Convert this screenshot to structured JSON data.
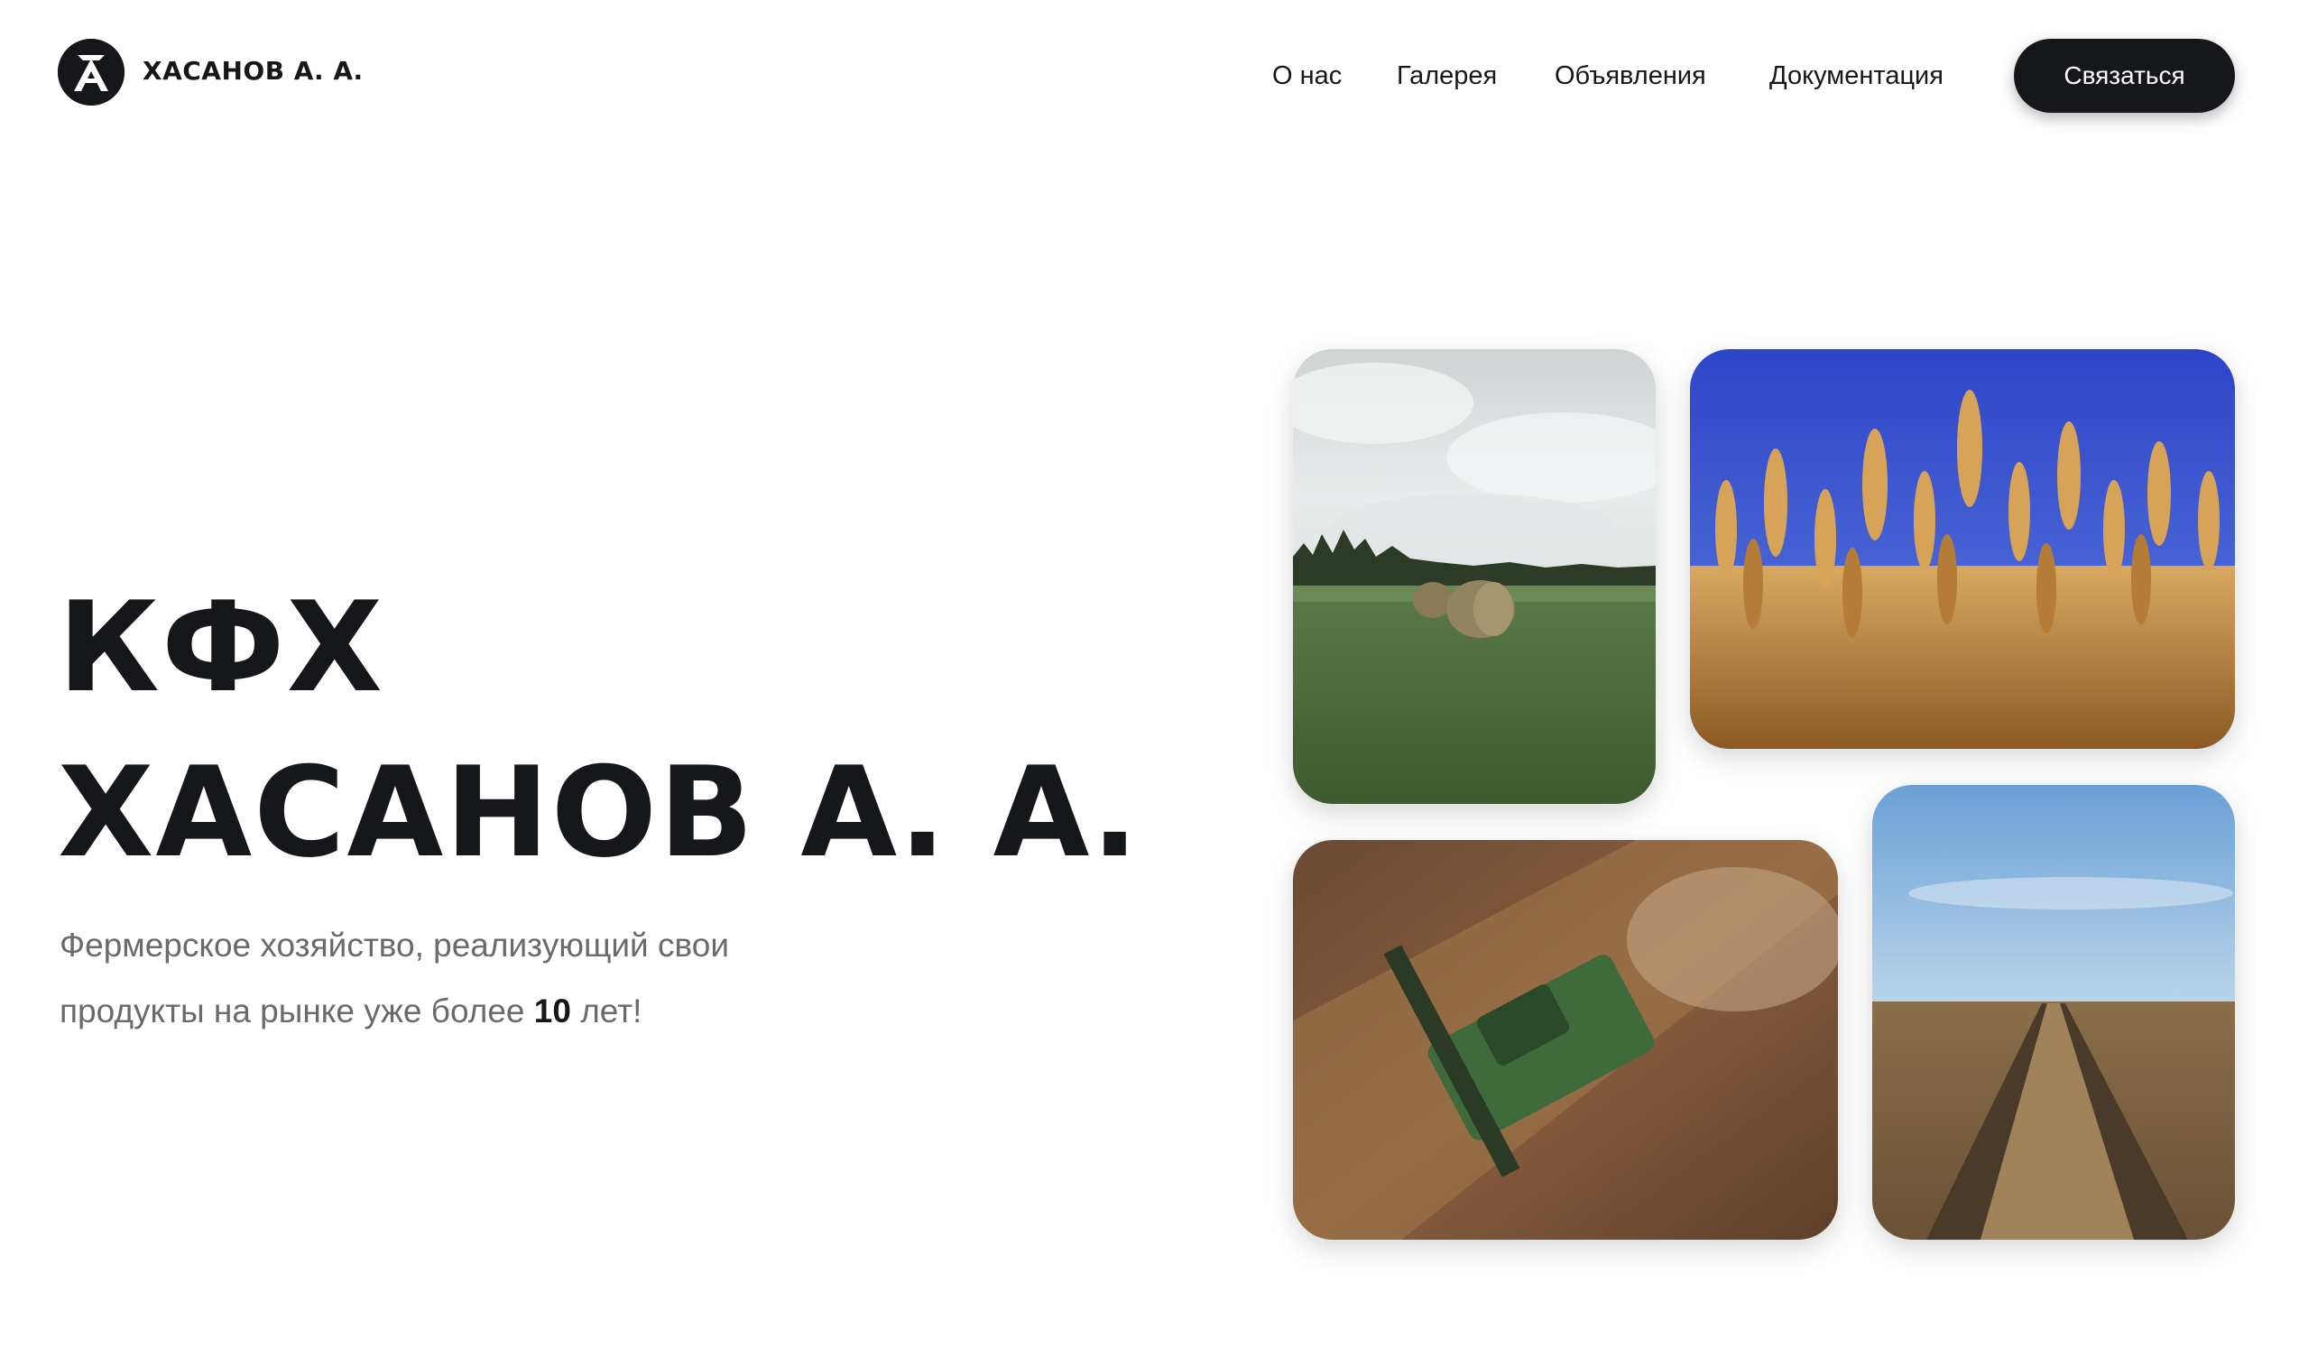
{
  "header": {
    "logo_icon": "tractor-letter-logo-icon",
    "logo_text": "ХАСАНОВ А. А.",
    "nav": [
      {
        "label": "О нас"
      },
      {
        "label": "Галерея"
      },
      {
        "label": "Объявления"
      },
      {
        "label": "Документация"
      }
    ],
    "cta_label": "Связаться"
  },
  "hero": {
    "title_line1": "КФХ",
    "title_line2": "ХАСАНОВ А. А.",
    "subtitle_line1": "Фермерское хозяйство, реализующий свои",
    "subtitle_line2_before": "продукты на рынке уже более ",
    "subtitle_years": "10",
    "subtitle_line2_after": " лет!"
  },
  "gallery": {
    "photos": [
      {
        "name": "hay-bales-field-photo"
      },
      {
        "name": "wheat-ears-sky-photo"
      },
      {
        "name": "combine-harvester-aerial-photo"
      },
      {
        "name": "wheat-field-rows-photo"
      }
    ]
  },
  "colors": {
    "text": "#16171b",
    "muted": "#6a6a6a",
    "button_bg": "#16171b",
    "button_text": "#ffffff",
    "background": "#ffffff"
  }
}
